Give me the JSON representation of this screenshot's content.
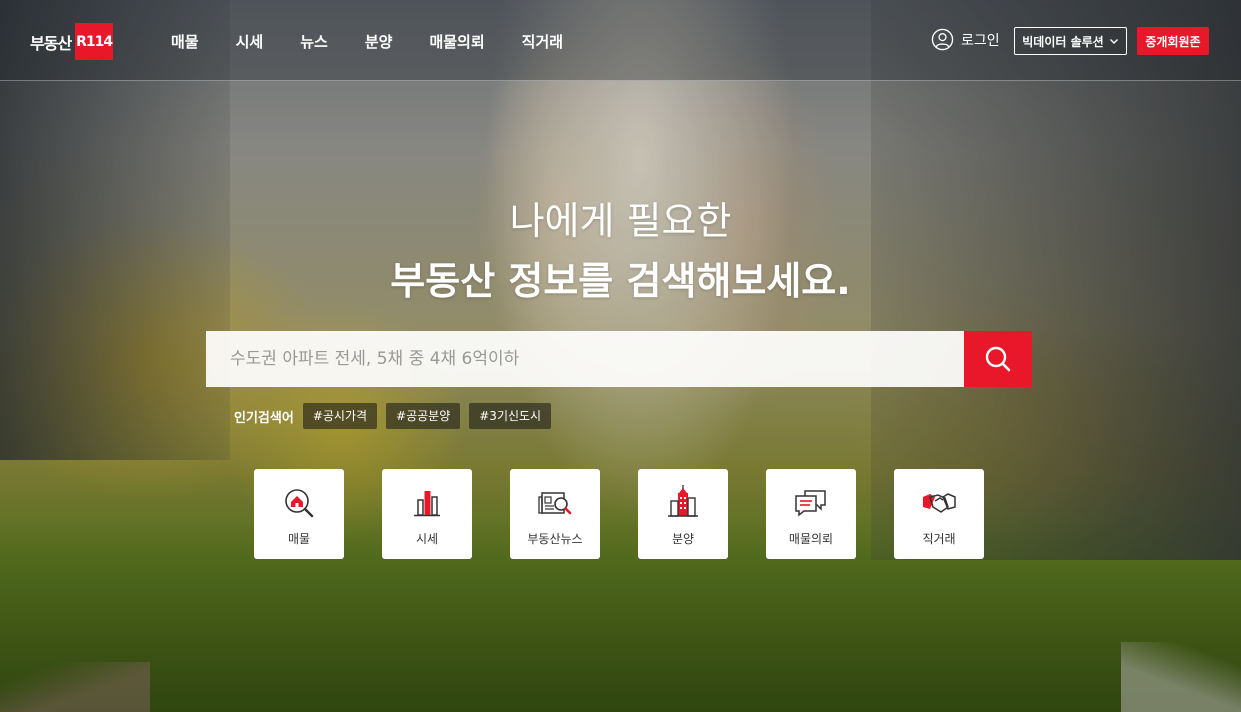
{
  "header": {
    "logo_text": "부동산",
    "logo_badge": "R114",
    "nav": [
      "매물",
      "시세",
      "뉴스",
      "분양",
      "매물의뢰",
      "직거래"
    ],
    "login_label": "로그인",
    "bigdata_label": "빅데이터 솔루션",
    "member_label": "중개회원존"
  },
  "hero": {
    "line1": "나에게 필요한",
    "line2": "부동산 정보를 검색해보세요."
  },
  "search": {
    "placeholder": "수도권 아파트 전세, 5채 중 4채 6억이하",
    "value": ""
  },
  "popular": {
    "label": "인기검색어",
    "tags": [
      "#공시가격",
      "#공공분양",
      "#3기신도시"
    ]
  },
  "quick_menu": [
    {
      "label": "매물",
      "icon": "house-search-icon"
    },
    {
      "label": "시세",
      "icon": "bar-chart-icon"
    },
    {
      "label": "부동산뉴스",
      "icon": "newspaper-search-icon"
    },
    {
      "label": "분양",
      "icon": "buildings-icon"
    },
    {
      "label": "매물의뢰",
      "icon": "chat-bubbles-icon"
    },
    {
      "label": "직거래",
      "icon": "handshake-icon"
    }
  ],
  "colors": {
    "brand_red": "#e8172a",
    "icon_dark": "#333333"
  }
}
